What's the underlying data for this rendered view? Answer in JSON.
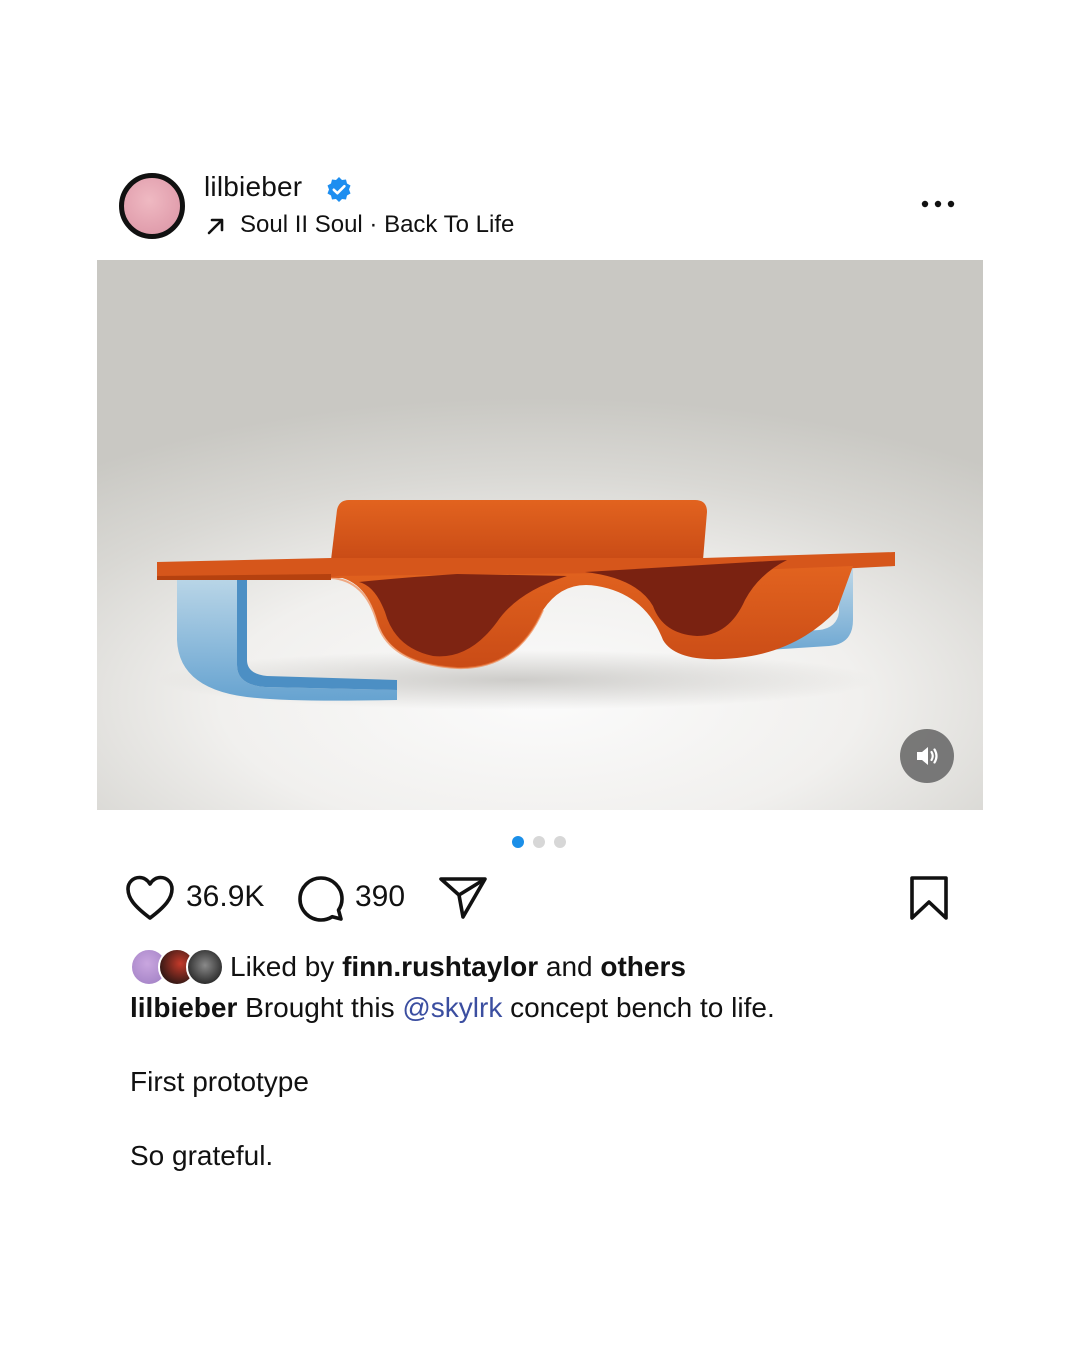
{
  "header": {
    "username": "lilbieber",
    "verified": true,
    "audio_label": "Soul II Soul · Back To Life",
    "more_icon": "more-horizontal-icon"
  },
  "media": {
    "carousel_total": 3,
    "carousel_active": 1,
    "mute_icon": "volume-icon"
  },
  "actions": {
    "likes_count": "36.9K",
    "comments_count": "390"
  },
  "liked_by": {
    "prefix": "Liked by",
    "user": "finn.rushtaylor",
    "and": "and",
    "others": "others"
  },
  "caption": {
    "username": "lilbieber",
    "text_before": "Brought this",
    "mention": "@skylrk",
    "text_after": "concept bench to life.",
    "line2": "First prototype",
    "line3": "So grateful."
  },
  "colors": {
    "verified": "#1d8ef0",
    "active_dot": "#1b8fe8",
    "mention": "#3b4ea0",
    "bench_wood": "#d8561c",
    "bench_fabric": "#7e2412",
    "bench_glass": "#8fbcd9"
  }
}
